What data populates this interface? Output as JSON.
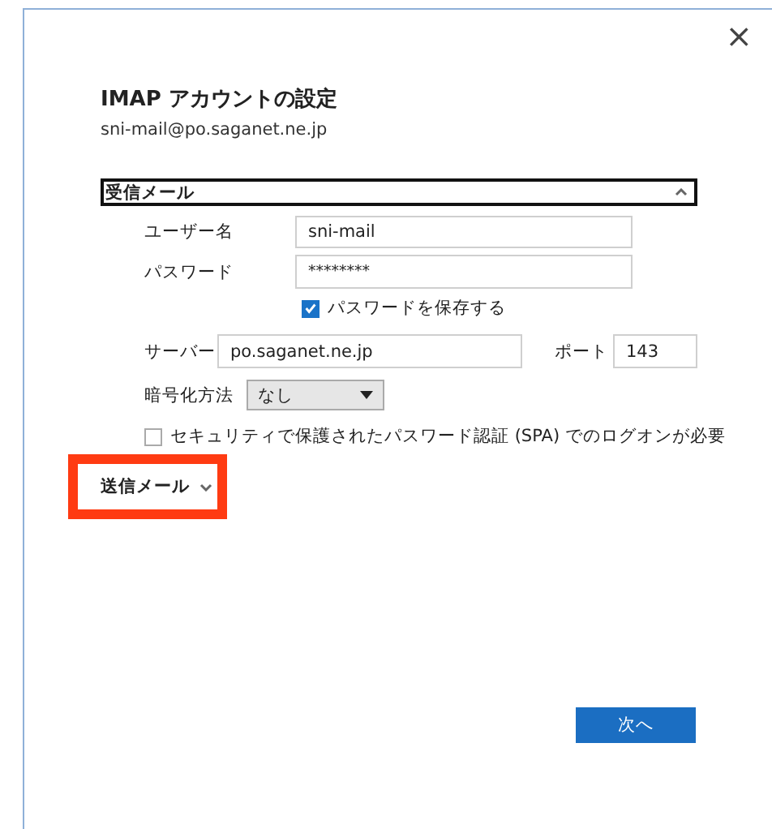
{
  "dialog": {
    "close": "×",
    "title": "IMAP アカウントの設定",
    "email": "sni-mail@po.saganet.ne.jp"
  },
  "incoming": {
    "label": "受信メール",
    "expanded": true,
    "username": {
      "label": "ユーザー名",
      "value": "sni-mail"
    },
    "password": {
      "label": "パスワード",
      "value": "********"
    },
    "save_password": {
      "label": "パスワードを保存する",
      "checked": true
    },
    "server": {
      "label": "サーバー",
      "value": "po.saganet.ne.jp"
    },
    "port": {
      "label": "ポート",
      "value": "143"
    },
    "encryption": {
      "label": "暗号化方法",
      "value": "なし"
    },
    "spa": {
      "label": "セキュリティで保護されたパスワード認証 (SPA) でのログオンが必要",
      "checked": false
    }
  },
  "outgoing": {
    "label": "送信メール",
    "expanded": false,
    "highlighted": true
  },
  "buttons": [
    {
      "label": "次へ",
      "kind": "primary"
    }
  ]
}
